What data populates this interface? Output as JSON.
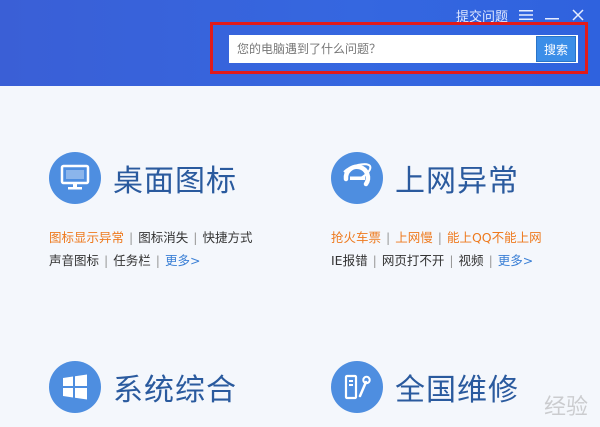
{
  "header": {
    "submit_label": "提交问题",
    "search_placeholder": "您的电脑遇到了什么问题？",
    "search_value": "",
    "search_button": "搜索"
  },
  "cards": [
    {
      "title": "桌面图标",
      "icon": "monitor-icon",
      "row1": [
        {
          "label": "图标显示异常",
          "style": "hot"
        },
        {
          "label": "图标消失",
          "style": "normal"
        },
        {
          "label": "快捷方式",
          "style": "normal"
        }
      ],
      "row2": [
        {
          "label": "声音图标",
          "style": "normal"
        },
        {
          "label": "任务栏",
          "style": "normal"
        },
        {
          "label": "更多>",
          "style": "more"
        }
      ]
    },
    {
      "title": "上网异常",
      "icon": "ie-browser-icon",
      "row1": [
        {
          "label": "抢火车票",
          "style": "hot"
        },
        {
          "label": "上网慢",
          "style": "hot"
        },
        {
          "label": "能上QQ不能上网",
          "style": "hot"
        }
      ],
      "row2": [
        {
          "label": "IE报错",
          "style": "normal"
        },
        {
          "label": "网页打不开",
          "style": "normal"
        },
        {
          "label": "视频",
          "style": "normal"
        },
        {
          "label": "更多>",
          "style": "more"
        }
      ]
    },
    {
      "title": "系统综合",
      "icon": "windows-logo-icon"
    },
    {
      "title": "全国维修",
      "icon": "repair-tools-icon"
    }
  ],
  "watermark": "经验",
  "colors": {
    "header": "#3567e0",
    "accent": "#4e8ee0",
    "hot_link": "#ee7a1e",
    "more_link": "#3a7fd5",
    "highlight": "#e11a1a"
  }
}
